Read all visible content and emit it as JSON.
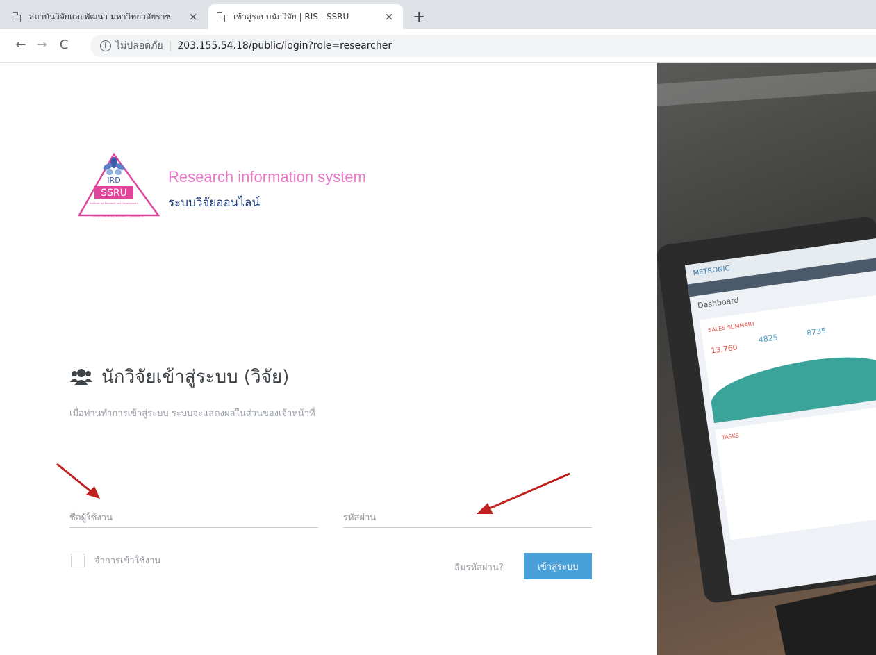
{
  "browser": {
    "tabs": [
      {
        "title": "สถาบันวิจัยและพัฒนา มหาวิทยาลัยราช",
        "close": "×",
        "active": false
      },
      {
        "title": "เข้าสู่ระบบนักวิจัย | RIS - SSRU",
        "close": "×",
        "active": true
      }
    ],
    "new_tab": "+",
    "nav": {
      "back": "←",
      "forward": "→",
      "reload": "C"
    },
    "address": {
      "info_glyph": "i",
      "security_label": "ไม่ปลอดภัย",
      "separator": "|",
      "url": "203.155.54.18/public/login?role=researcher"
    }
  },
  "brand": {
    "logo_text_top": "IRD",
    "logo_text_mid": "SSRU",
    "logo_tagline": "Institute for Research and Development",
    "logo_footer": "SUAN SUNANDHA RAJABHAT UNIVERSITY",
    "title": "Research information system",
    "subtitle": "ระบบวิจัยออนไลน์",
    "title_color": "#e878c8",
    "subtitle_color": "#1b3b7a"
  },
  "login": {
    "icon": "users-icon",
    "heading": "นักวิจัยเข้าสู่ระบบ (วิจัย)",
    "description": "เมื่อท่านทำการเข้าสู่ระบบ ระบบจะแสดงผลในส่วนของเจ้าหน้าที่",
    "username_placeholder": "ชื่อผู้ใช้งาน",
    "username_value": "",
    "password_placeholder": "รหัสผ่าน",
    "password_value": "",
    "remember_label": "จำการเข้าใช้งาน",
    "remember_checked": false,
    "forgot_label": "ลืมรหัสผ่าน?",
    "submit_label": "เข้าสู่ระบบ",
    "button_color": "#4aa0d8"
  },
  "annotations": {
    "arrow_color": "#c0201e"
  },
  "background_photo": {
    "screen_brand": "METRONIC",
    "screen_title": "Dashboard",
    "card_title": "SALES SUMMARY",
    "value_a": "13,760",
    "value_b": "4825",
    "value_c": "8735",
    "tasks_title": "TASKS"
  }
}
